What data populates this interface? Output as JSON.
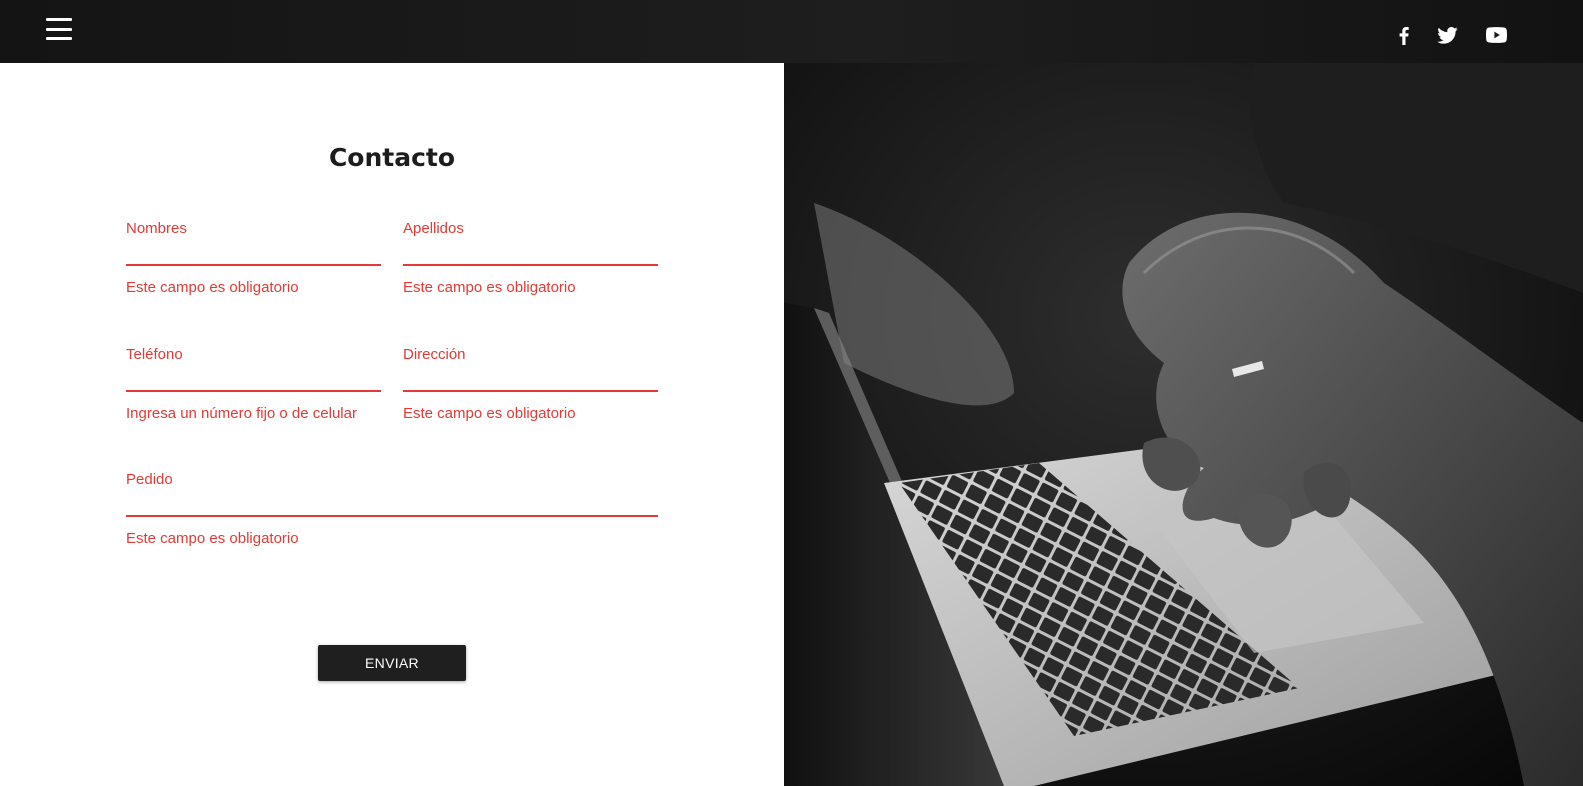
{
  "header": {
    "menu_icon": "hamburger-menu-icon",
    "social": [
      {
        "name": "facebook",
        "icon": "facebook-icon"
      },
      {
        "name": "twitter",
        "icon": "twitter-icon"
      },
      {
        "name": "youtube",
        "icon": "youtube-icon"
      }
    ]
  },
  "form": {
    "title": "Contacto",
    "fields": {
      "nombres": {
        "label": "Nombres",
        "value": "",
        "error": "Este campo es obligatorio"
      },
      "apellidos": {
        "label": "Apellidos",
        "value": "",
        "error": "Este campo es obligatorio"
      },
      "telefono": {
        "label": "Teléfono",
        "value": "",
        "error": "Ingresa un número fijo o de celular"
      },
      "direccion": {
        "label": "Dirección",
        "value": "",
        "error": "Este campo es obligatorio"
      },
      "pedido": {
        "label": "Pedido",
        "value": "",
        "error": "Este campo es obligatorio"
      }
    },
    "submit_label": "ENVIAR"
  },
  "colors": {
    "accent": "#e53935",
    "header_bg": "#1a1a1a",
    "button_bg": "#1f1f1f"
  }
}
